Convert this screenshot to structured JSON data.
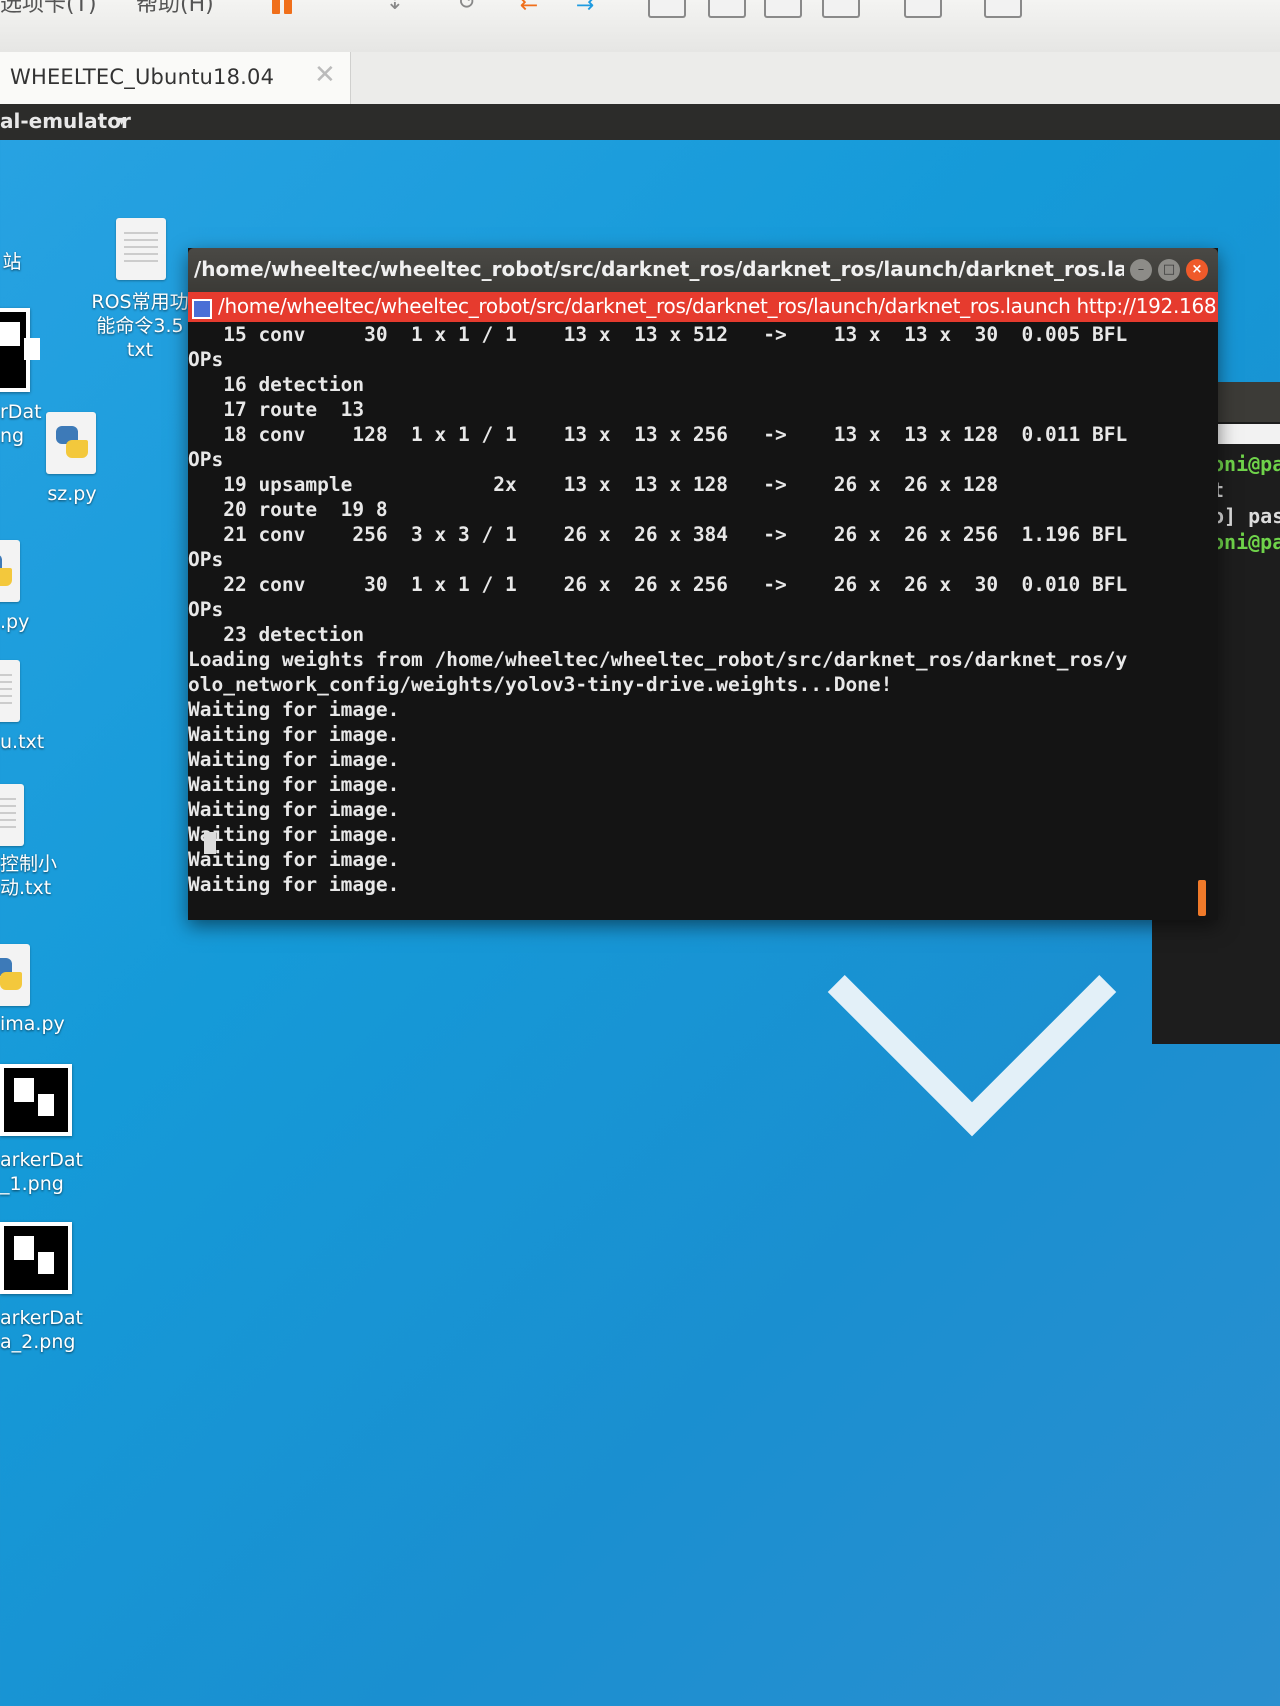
{
  "host": {
    "menu": [
      "选项卡(T)",
      "帮助(H)"
    ],
    "vm_tab": "WHEELTEC_Ubuntu18.04",
    "vm_tab_close": "✕"
  },
  "ubuntu_bar": {
    "app_menu": "al-emulator",
    "app_menu_arrow": "▾"
  },
  "desktop": {
    "icons": [
      {
        "label": "站"
      },
      {
        "label": "ROS常用功\n能命令3.5\ntxt"
      },
      {
        "label": "rDat\nng"
      },
      {
        "label": "sz.py"
      },
      {
        "label": ".py"
      },
      {
        "label": "u.txt"
      },
      {
        "label": "控制小\n动.txt"
      },
      {
        "label": "ima.py"
      },
      {
        "label": "arkerDat\n_1.png"
      },
      {
        "label": "arkerDat\na_2.png"
      }
    ]
  },
  "terminal": {
    "title": "/home/wheeltec/wheeltec_robot/src/darknet_ros/darknet_ros/launch/darknet_ros.launch ...",
    "tab": "/home/wheeltec/wheeltec_robot/src/darknet_ros/darknet_ros/launch/darknet_ros.launch http://192.168",
    "lines": [
      "   15 conv     30  1 x 1 / 1    13 x  13 x 512   ->    13 x  13 x  30  0.005 BFL",
      "OPs",
      "   16 detection",
      "   17 route  13",
      "   18 conv    128  1 x 1 / 1    13 x  13 x 256   ->    13 x  13 x 128  0.011 BFL",
      "OPs",
      "   19 upsample            2x    13 x  13 x 128   ->    26 x  26 x 128",
      "   20 route  19 8",
      "   21 conv    256  3 x 3 / 1    26 x  26 x 384   ->    26 x  26 x 256  1.196 BFL",
      "OPs",
      "   22 conv     30  1 x 1 / 1    26 x  26 x 256   ->    26 x  26 x  30  0.010 BFL",
      "OPs",
      "   23 detection",
      "Loading weights from /home/wheeltec/wheeltec_robot/src/darknet_ros/darknet_ros/y",
      "olo_network_config/weights/yolov3-tiny-drive.weights...Done!",
      "Waiting for image.",
      "Waiting for image.",
      "Waiting for image.",
      "Waiting for image.",
      "Waiting for image.",
      "Waiting for image.",
      "Waiting for image.",
      "Waiting for image."
    ]
  },
  "bg_terminal": {
    "lines": [
      {
        "text": "oni@pa",
        "color": "green"
      },
      {
        "text": "t",
        "color": "grey"
      },
      {
        "text": "o] pas",
        "color": "grey"
      },
      {
        "text": "oni@pa",
        "color": "green"
      }
    ]
  }
}
